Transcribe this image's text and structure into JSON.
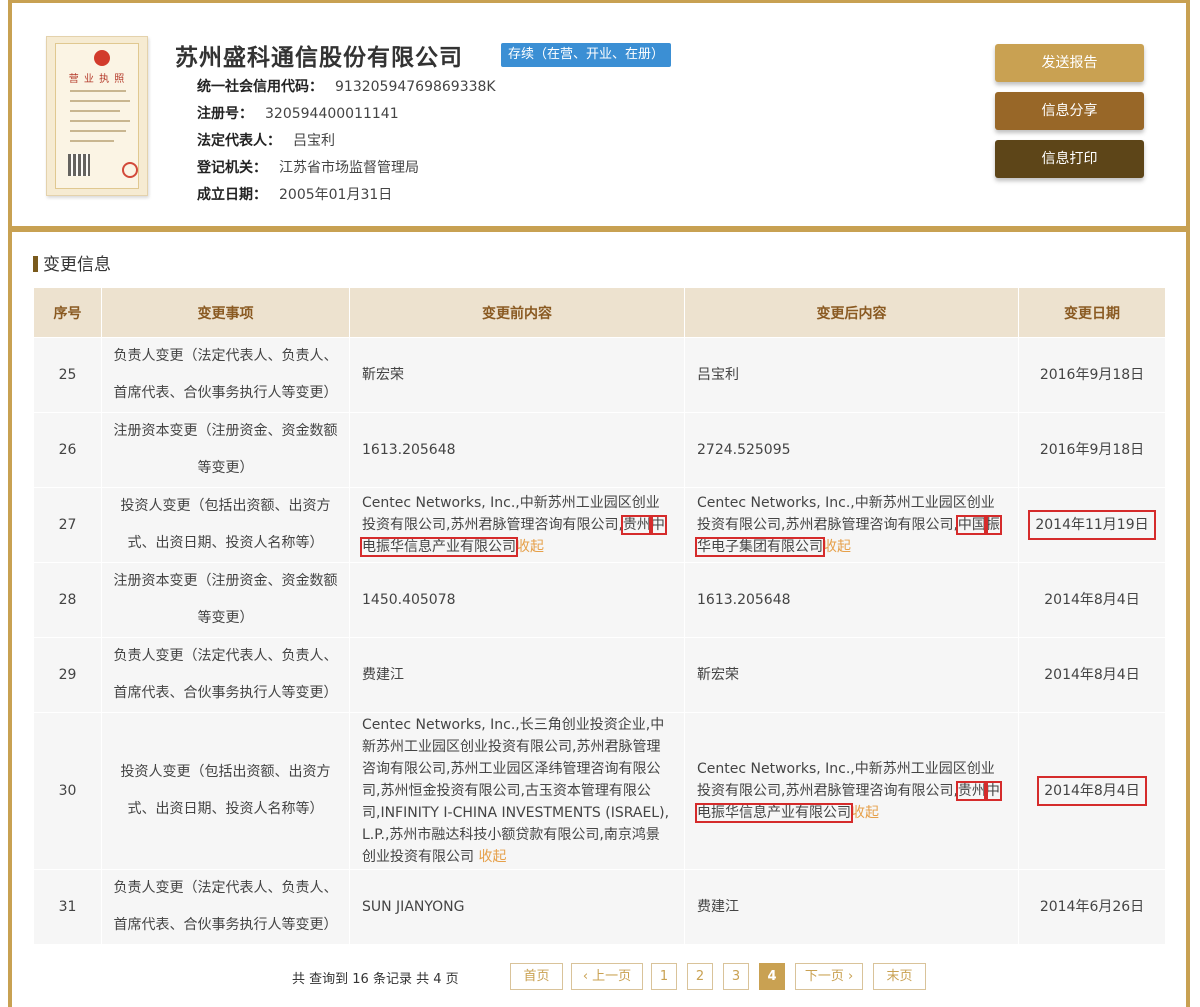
{
  "company": {
    "name": "苏州盛科通信股份有限公司",
    "status": "存续（在营、开业、在册）",
    "info": [
      {
        "label": "统一社会信用代码：",
        "value": "91320594769869338K"
      },
      {
        "label": "注册号：",
        "value": "320594400011141"
      },
      {
        "label": "法定代表人：",
        "value": "吕宝利"
      },
      {
        "label": "登记机关：",
        "value": "江苏省市场监督管理局"
      },
      {
        "label": "成立日期：",
        "value": "2005年01月31日"
      }
    ],
    "license_title": "营 业 执 照"
  },
  "actions": {
    "send_report": "发送报告",
    "share": "信息分享",
    "print": "信息打印"
  },
  "section": {
    "title": "变更信息"
  },
  "table": {
    "headers": [
      "序号",
      "变更事项",
      "变更前内容",
      "变更后内容",
      "变更日期"
    ],
    "rows": [
      {
        "seq": "25",
        "item": "负责人变更（法定代表人、负责人、首席代表、合伙事务执行人等变更）",
        "before": "靳宏荣",
        "after": "吕宝利",
        "date": "2016年9月18日"
      },
      {
        "seq": "26",
        "item": "注册资本变更（注册资金、资金数额等变更）",
        "before": "1613.205648",
        "after": "2724.525095",
        "date": "2016年9月18日"
      },
      {
        "seq": "27",
        "item": "投资人变更（包括出资额、出资方式、出资日期、投资人名称等）",
        "before_plain": "Centec Networks, Inc.,中新苏州工业园区创业投资有限公司,苏州君脉管理咨询有限公司,",
        "before_hl_a": "贵州",
        "before_hl_b": "中电振华信息产业有限公司",
        "after_plain": "Centec Networks, Inc.,中新苏州工业园区创业投资有限公司,苏州君脉管理咨询有限公司,",
        "after_hl_a": "中国",
        "after_hl_b": "振华电子集团有限公司",
        "date": "2014年11月19日"
      },
      {
        "seq": "28",
        "item": "注册资本变更（注册资金、资金数额等变更）",
        "before": "1450.405078",
        "after": "1613.205648",
        "date": "2014年8月4日"
      },
      {
        "seq": "29",
        "item": "负责人变更（法定代表人、负责人、首席代表、合伙事务执行人等变更）",
        "before": "费建江",
        "after": "靳宏荣",
        "date": "2014年8月4日"
      },
      {
        "seq": "30",
        "item": "投资人变更（包括出资额、出资方式、出资日期、投资人名称等）",
        "before": "Centec Networks, Inc.,长三角创业投资企业,中新苏州工业园区创业投资有限公司,苏州君脉管理咨询有限公司,苏州工业园区泽纬管理咨询有限公司,苏州恒金投资有限公司,古玉资本管理有限公司,INFINITY I-CHINA INVESTMENTS (ISRAEL), L.P.,苏州市融达科技小额贷款有限公司,南京鸿景创业投资有限公司",
        "after_plain": "Centec Networks, Inc.,中新苏州工业园区创业投资有限公司,苏州君脉管理咨询有限公司,",
        "after_hl_a": "贵州",
        "after_hl_b": "中电振华信息产业有限公司",
        "date": "2014年8月4日"
      },
      {
        "seq": "31",
        "item": "负责人变更（法定代表人、负责人、首席代表、合伙事务执行人等变更）",
        "before": "SUN JIANYONG",
        "after": "费建江",
        "date": "2014年6月26日"
      }
    ],
    "collapse_label": "收起"
  },
  "pagination": {
    "summary": "共 查询到 16 条记录 共 4 页",
    "first": "首页",
    "prev": "‹ 上一页",
    "pages": [
      "1",
      "2",
      "3",
      "4"
    ],
    "current": "4",
    "next": "下一页 ›",
    "last": "末页"
  },
  "colors": {
    "accent": "#c8a152",
    "status_badge": "#3b8fd4",
    "highlight_box": "#d52b2b",
    "collapse_link": "#e6a04a"
  }
}
